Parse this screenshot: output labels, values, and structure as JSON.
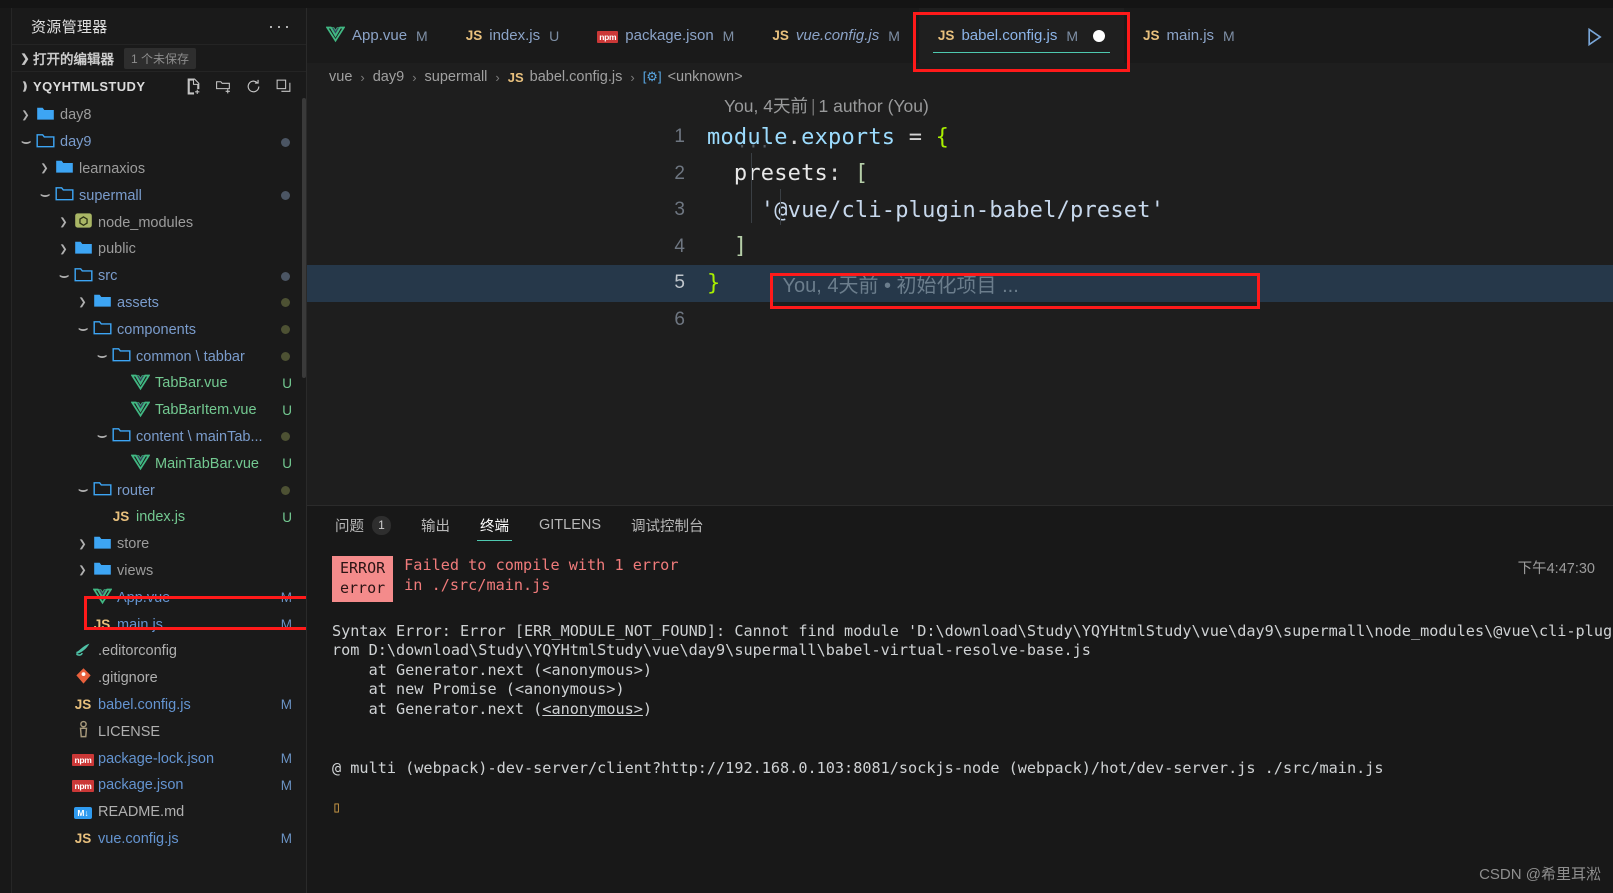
{
  "sidebar": {
    "title": "资源管理器",
    "more_label": "···",
    "open_editors": {
      "label": "打开的编辑器",
      "badge": "1 个未保存"
    },
    "root": {
      "label": "YQYHTMLSTUDY",
      "actions": [
        "new-file-icon",
        "new-folder-icon",
        "refresh-icon",
        "collapse-all-icon"
      ]
    },
    "tree": [
      {
        "name": "day8",
        "indent": 1,
        "kind": "folder",
        "state": "collapsed",
        "icon": "folder-closed-icon",
        "mark": ""
      },
      {
        "name": "day9",
        "indent": 1,
        "kind": "folder",
        "state": "expanded",
        "icon": "folder-open-icon",
        "mark": "",
        "dot": "#4b5563"
      },
      {
        "name": "learnaxios",
        "indent": 2,
        "kind": "folder",
        "state": "collapsed",
        "icon": "folder-closed-icon",
        "mark": ""
      },
      {
        "name": "supermall",
        "indent": 2,
        "kind": "folder",
        "state": "expanded",
        "icon": "folder-open-icon",
        "mark": "",
        "dot": "#4b5563"
      },
      {
        "name": "node_modules",
        "indent": 3,
        "kind": "folder",
        "state": "collapsed",
        "icon": "node-modules-icon",
        "mark": ""
      },
      {
        "name": "public",
        "indent": 3,
        "kind": "folder",
        "state": "collapsed",
        "icon": "folder-closed-icon",
        "mark": ""
      },
      {
        "name": "src",
        "indent": 3,
        "kind": "folder",
        "state": "expanded",
        "icon": "folder-open-icon",
        "mark": "",
        "dot": "#4b5563"
      },
      {
        "name": "assets",
        "indent": 4,
        "kind": "folder",
        "state": "collapsed",
        "icon": "folder-closed-icon",
        "mark": "",
        "dot": "#4d5133"
      },
      {
        "name": "components",
        "indent": 4,
        "kind": "folder",
        "state": "expanded",
        "icon": "folder-open-icon",
        "mark": "",
        "dot": "#4d5133"
      },
      {
        "name": "common \\ tabbar",
        "indent": 5,
        "kind": "folder",
        "state": "expanded",
        "icon": "folder-open-icon",
        "mark": "",
        "dot": "#4d5133"
      },
      {
        "name": "TabBar.vue",
        "indent": 6,
        "kind": "file",
        "icon": "vue-icon",
        "mark": "U"
      },
      {
        "name": "TabBarItem.vue",
        "indent": 6,
        "kind": "file",
        "icon": "vue-icon",
        "mark": "U"
      },
      {
        "name": "content \\ mainTab...",
        "indent": 5,
        "kind": "folder",
        "state": "expanded",
        "icon": "folder-open-icon",
        "mark": "",
        "dot": "#4d5133"
      },
      {
        "name": "MainTabBar.vue",
        "indent": 6,
        "kind": "file",
        "icon": "vue-icon",
        "mark": "U"
      },
      {
        "name": "router",
        "indent": 4,
        "kind": "folder",
        "state": "expanded",
        "icon": "folder-open-icon",
        "mark": "",
        "dot": "#4d5133"
      },
      {
        "name": "index.js",
        "indent": 5,
        "kind": "file",
        "icon": "js-icon",
        "mark": "U"
      },
      {
        "name": "store",
        "indent": 4,
        "kind": "folder",
        "state": "collapsed",
        "icon": "folder-closed-icon",
        "mark": ""
      },
      {
        "name": "views",
        "indent": 4,
        "kind": "folder",
        "state": "collapsed",
        "icon": "folder-closed-icon",
        "mark": ""
      },
      {
        "name": "App.vue",
        "indent": 4,
        "kind": "file",
        "icon": "vue-icon",
        "mark": "M"
      },
      {
        "name": "main.js",
        "indent": 4,
        "kind": "file",
        "icon": "js-icon",
        "mark": "M"
      },
      {
        "name": ".editorconfig",
        "indent": 3,
        "kind": "file",
        "icon": "editorconfig-icon",
        "mark": ""
      },
      {
        "name": ".gitignore",
        "indent": 3,
        "kind": "file",
        "icon": "git-icon",
        "mark": ""
      },
      {
        "name": "babel.config.js",
        "indent": 3,
        "kind": "file",
        "icon": "js-icon",
        "mark": "M",
        "highlight": true
      },
      {
        "name": "LICENSE",
        "indent": 3,
        "kind": "file",
        "icon": "license-icon",
        "mark": ""
      },
      {
        "name": "package-lock.json",
        "indent": 3,
        "kind": "file",
        "icon": "npm-icon",
        "mark": "M"
      },
      {
        "name": "package.json",
        "indent": 3,
        "kind": "file",
        "icon": "npm-icon",
        "mark": "M"
      },
      {
        "name": "README.md",
        "indent": 3,
        "kind": "file",
        "icon": "markdown-icon",
        "mark": ""
      },
      {
        "name": "vue.config.js",
        "indent": 3,
        "kind": "file",
        "icon": "js-icon",
        "mark": "M"
      }
    ]
  },
  "tabs": [
    {
      "name": "App.vue",
      "icon": "vue-icon",
      "status": "M",
      "active": false,
      "italic": false,
      "dirty": false
    },
    {
      "name": "index.js",
      "icon": "js-icon",
      "status": "U",
      "active": false,
      "italic": false,
      "dirty": false
    },
    {
      "name": "package.json",
      "icon": "npm-icon",
      "status": "M",
      "active": false,
      "italic": false,
      "dirty": false
    },
    {
      "name": "vue.config.js",
      "icon": "js-icon",
      "status": "M",
      "active": false,
      "italic": true,
      "dirty": false
    },
    {
      "name": "babel.config.js",
      "icon": "js-icon",
      "status": "M",
      "active": true,
      "italic": false,
      "dirty": true
    },
    {
      "name": "main.js",
      "icon": "js-icon",
      "status": "M",
      "active": false,
      "italic": false,
      "dirty": false
    }
  ],
  "run_icon": "run-play-icon",
  "breadcrumb": {
    "parts": [
      "vue",
      "day9",
      "supermall"
    ],
    "file": "babel.config.js",
    "symbol": "<unknown>"
  },
  "editor": {
    "codelens": "You, 4天前 | 1 author (You)",
    "codelens_author": "You, 4天前",
    "codelens_authors": "1 author (You)",
    "lines": [
      {
        "no": "1",
        "text": "module.exports = {"
      },
      {
        "no": "2",
        "text": "  presets: ["
      },
      {
        "no": "3",
        "text": "    '@vue/cli-plugin-babel/preset'"
      },
      {
        "no": "4",
        "text": "  ]"
      },
      {
        "no": "5",
        "text": "}"
      },
      {
        "no": "6",
        "text": ""
      }
    ],
    "inline_blame": "You, 4天前 • 初始化项目 ...",
    "fold_dots": "···"
  },
  "panel": {
    "tabs": [
      {
        "label": "问题",
        "count": "1",
        "selected": false
      },
      {
        "label": "输出",
        "count": "",
        "selected": false
      },
      {
        "label": "终端",
        "count": "",
        "selected": true
      },
      {
        "label": "GITLENS",
        "count": "",
        "selected": false
      },
      {
        "label": "调试控制台",
        "count": "",
        "selected": false
      }
    ],
    "timestamp": "下午4:47:30",
    "error_tag_line1": "ERROR",
    "error_tag_line2": "error",
    "error_line1": "Failed to compile with 1 error",
    "error_line2": "in ./src/main.js",
    "terminal_lines": [
      "Syntax Error: Error [ERR_MODULE_NOT_FOUND]: Cannot find module 'D:\\download\\Study\\YQYHtmlStudy\\vue\\day9\\supermall\\node_modules\\@vue\\cli-plugin-babel\\preset' imported f",
      "rom D:\\download\\Study\\YQYHtmlStudy\\vue\\day9\\supermall\\babel-virtual-resolve-base.js",
      "    at Generator.next (<anonymous>)",
      "    at new Promise (<anonymous>)",
      "    at Generator.next (<anonymous>)"
    ],
    "webpack_line": "@ multi (webpack)-dev-server/client?http://192.168.0.103:8081/sockjs-node (webpack)/hot/dev-server.js ./src/main.js",
    "cursor": "▯"
  },
  "watermark": "CSDN @希里耳淞",
  "colors": {
    "accent": "#4ec9b0",
    "highlight_box": "#ff1a1a",
    "error_red": "#f07b7b",
    "current_line": "#26384a"
  }
}
